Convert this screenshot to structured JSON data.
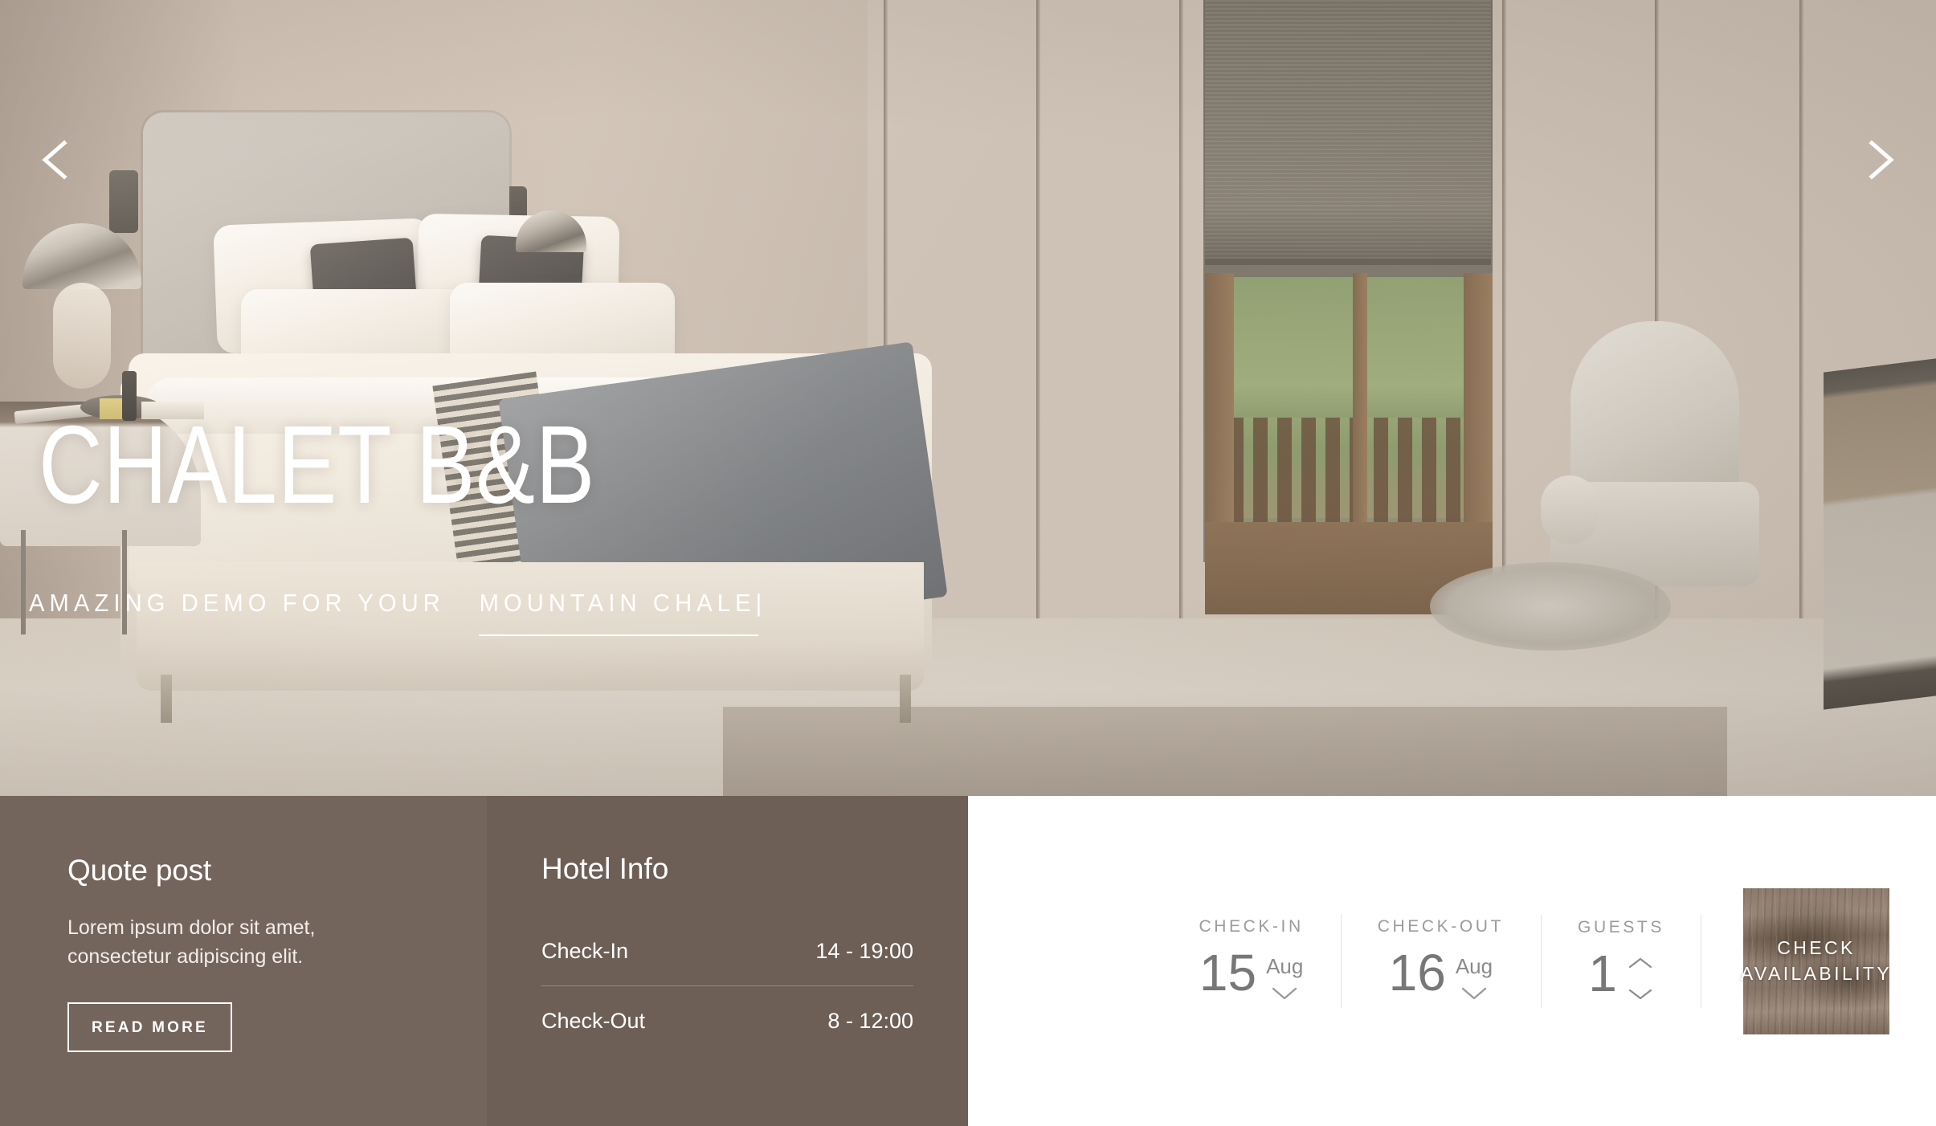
{
  "hero": {
    "title": "CHALET B&B",
    "subtitle_static": "AMAZING DEMO FOR YOUR",
    "subtitle_typed": "MOUNTAIN CHALE",
    "caret": "|",
    "prev_arrow": "prev-slide-arrow",
    "next_arrow": "next-slide-arrow"
  },
  "quote": {
    "title": "Quote post",
    "text": "Lorem ipsum dolor sit amet, consectetur adipiscing elit.",
    "button_label": "READ MORE",
    "bg_color": "#74655c"
  },
  "hotel_info": {
    "title": "Hotel Info",
    "rows": [
      {
        "label": "Check-In",
        "value": "14 - 19:00"
      },
      {
        "label": "Check-Out",
        "value": "8 - 12:00"
      }
    ],
    "bg_color": "#6d5f56"
  },
  "booking": {
    "check_in": {
      "label": "CHECK-IN",
      "day": "15",
      "month": "Aug",
      "chevron": "chevron-down-icon"
    },
    "check_out": {
      "label": "CHECK-OUT",
      "day": "16",
      "month": "Aug",
      "chevron": "chevron-down-icon"
    },
    "guests": {
      "label": "GUESTS",
      "count": "1",
      "up_icon": "chevron-up-icon",
      "down_icon": "chevron-down-icon"
    },
    "cta": {
      "line1": "CHECK",
      "line2": "AVAILABILITY"
    },
    "label_color": "#9b9b9b",
    "value_color": "#777777"
  }
}
